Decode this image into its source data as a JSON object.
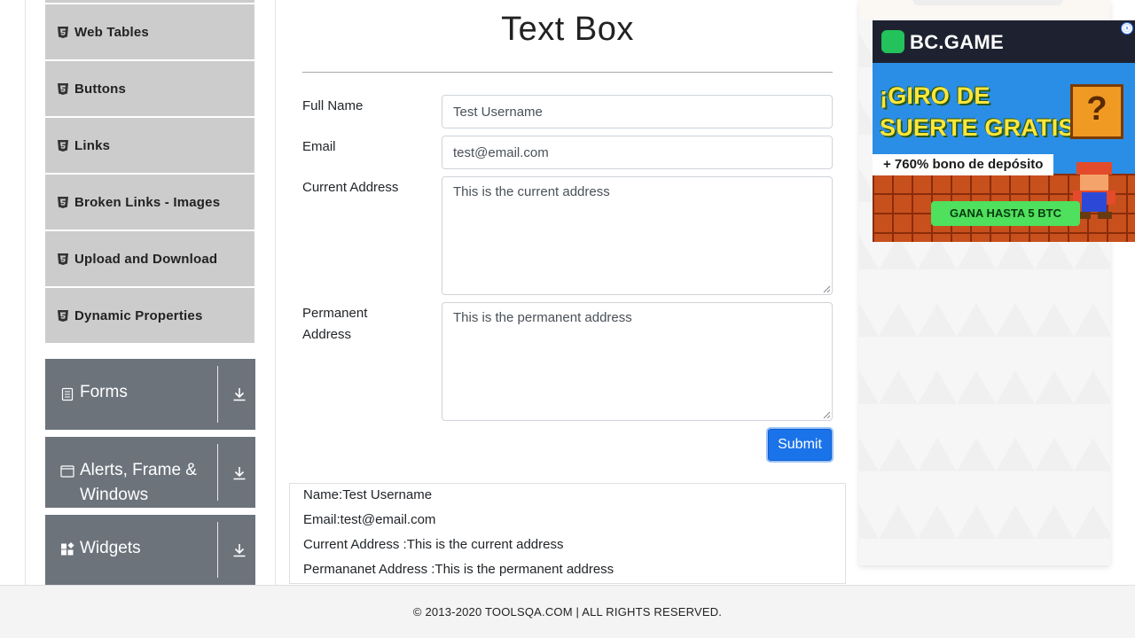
{
  "nav": {
    "sub_items": [
      {
        "label": "Web Tables"
      },
      {
        "label": "Buttons"
      },
      {
        "label": "Links"
      },
      {
        "label": "Broken Links - Images"
      },
      {
        "label": "Upload and Download"
      },
      {
        "label": "Dynamic Properties"
      }
    ],
    "groups": [
      {
        "label": "Forms",
        "icon": "form-icon"
      },
      {
        "label": "Alerts, Frame &",
        "label2": "Windows",
        "icon": "window-icon"
      },
      {
        "label": "Widgets",
        "icon": "widgets-icon"
      }
    ]
  },
  "page": {
    "title": "Text Box"
  },
  "form": {
    "full_name_label": "Full Name",
    "full_name_value": "Test Username",
    "email_label": "Email",
    "email_value": "test@email.com",
    "current_address_label": "Current Address",
    "current_address_value": "This is the current address",
    "permanent_address_label_1": "Permanent",
    "permanent_address_label_2": "Address",
    "permanent_address_value": "This is the permanent address",
    "submit_label": "Submit"
  },
  "output": {
    "name": "Name:Test Username",
    "email": "Email:test@email.com",
    "current_address": "Current Address :This is the current address",
    "permanent_address": "Permananet Address :This is the permanent address"
  },
  "ad": {
    "brand": "BC.GAME",
    "headline_1": "¡GIRO DE",
    "headline_2": "SUERTE GRATIS!",
    "bonus": "+ 760% bono de depósito",
    "cta": "GANA HASTA 5 BTC",
    "question_mark": "?",
    "close_glyph": "ⓧ"
  },
  "footer": {
    "text": "© 2013-2020 TOOLSQA.COM | ALL RIGHTS RESERVED."
  },
  "colors": {
    "nav_sub_bg": "#cccccc",
    "nav_group_bg": "#6c737b",
    "submit_bg": "#1a73e8",
    "footer_bg": "#f4f4f4"
  }
}
